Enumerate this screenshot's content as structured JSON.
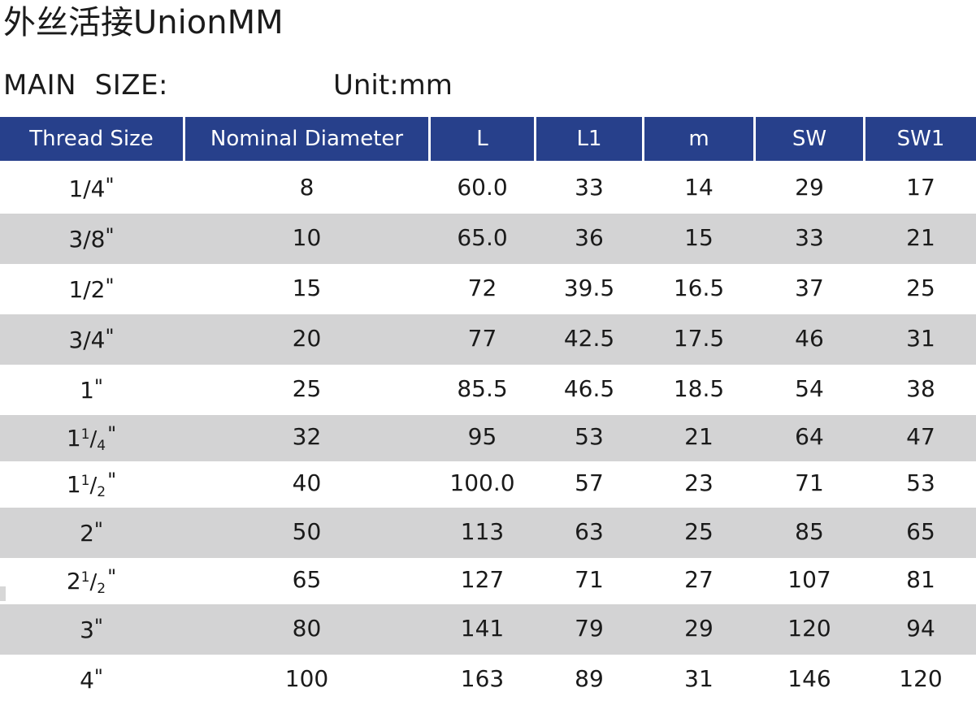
{
  "document": {
    "title": "外丝活接UnionMM",
    "subtitle": "MAIN  SIZE:",
    "unit_note": "Unit:mm"
  },
  "colors": {
    "header_blue": "#27408B",
    "row_gray": "#D3D3D4",
    "row_white": "#FFFFFF",
    "text": "#1A1A1A",
    "header_text": "#FFFFFF"
  },
  "table": {
    "columns": [
      "Thread Size",
      "Nominal Diameter",
      "L",
      "L1",
      "m",
      "SW",
      "SW1"
    ],
    "rows": [
      {
        "thread_whole": "1/4",
        "thread_num": "",
        "thread_den": "",
        "thread_display": "1/4\"",
        "nominal": "8",
        "L": "60.0",
        "L1": "33",
        "m": "14",
        "SW": "29",
        "SW1": "17"
      },
      {
        "thread_whole": "3/8",
        "thread_num": "",
        "thread_den": "",
        "thread_display": "3/8\"",
        "nominal": "10",
        "L": "65.0",
        "L1": "36",
        "m": "15",
        "SW": "33",
        "SW1": "21"
      },
      {
        "thread_whole": "1/2",
        "thread_num": "",
        "thread_den": "",
        "thread_display": "1/2\"",
        "nominal": "15",
        "L": "72",
        "L1": "39.5",
        "m": "16.5",
        "SW": "37",
        "SW1": "25"
      },
      {
        "thread_whole": "3/4",
        "thread_num": "",
        "thread_den": "",
        "thread_display": "3/4\"",
        "nominal": "20",
        "L": "77",
        "L1": "42.5",
        "m": "17.5",
        "SW": "46",
        "SW1": "31"
      },
      {
        "thread_whole": "1",
        "thread_num": "",
        "thread_den": "",
        "thread_display": "1\"",
        "nominal": "25",
        "L": "85.5",
        "L1": "46.5",
        "m": "18.5",
        "SW": "54",
        "SW1": "38"
      },
      {
        "thread_whole": "1",
        "thread_num": "1",
        "thread_den": "4",
        "thread_display": "1 1/4\"",
        "nominal": "32",
        "L": "95",
        "L1": "53",
        "m": "21",
        "SW": "64",
        "SW1": "47"
      },
      {
        "thread_whole": "1",
        "thread_num": "1",
        "thread_den": "2",
        "thread_display": "1 1/2\"",
        "nominal": "40",
        "L": "100.0",
        "L1": "57",
        "m": "23",
        "SW": "71",
        "SW1": "53"
      },
      {
        "thread_whole": "2",
        "thread_num": "",
        "thread_den": "",
        "thread_display": "2\"",
        "nominal": "50",
        "L": "113",
        "L1": "63",
        "m": "25",
        "SW": "85",
        "SW1": "65"
      },
      {
        "thread_whole": "2",
        "thread_num": "1",
        "thread_den": "2",
        "thread_display": "2 1/2\"",
        "nominal": "65",
        "L": "127",
        "L1": "71",
        "m": "27",
        "SW": "107",
        "SW1": "81"
      },
      {
        "thread_whole": "3",
        "thread_num": "",
        "thread_den": "",
        "thread_display": "3\"",
        "nominal": "80",
        "L": "141",
        "L1": "79",
        "m": "29",
        "SW": "120",
        "SW1": "94"
      },
      {
        "thread_whole": "4",
        "thread_num": "",
        "thread_den": "",
        "thread_display": "4\"",
        "nominal": "100",
        "L": "163",
        "L1": "89",
        "m": "31",
        "SW": "146",
        "SW1": "120"
      }
    ]
  }
}
